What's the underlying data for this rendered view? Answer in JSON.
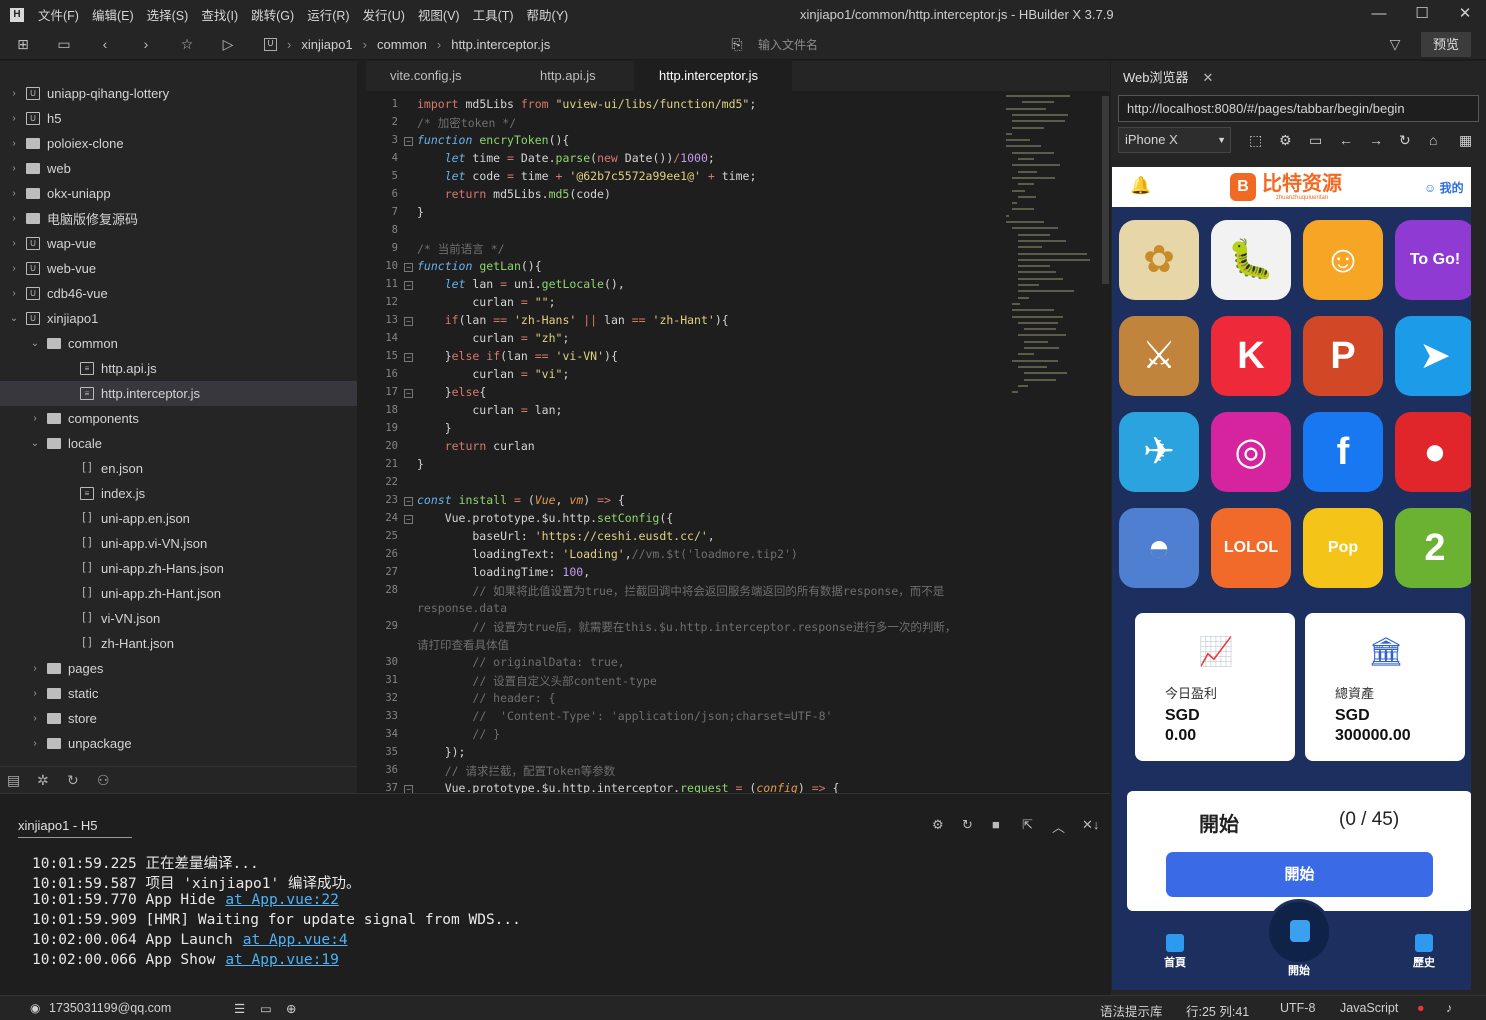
{
  "window": {
    "title": "xinjiapo1/common/http.interceptor.js - HBuilder X 3.7.9",
    "menu": [
      "文件(F)",
      "编辑(E)",
      "选择(S)",
      "查找(I)",
      "跳转(G)",
      "运行(R)",
      "发行(U)",
      "视图(V)",
      "工具(T)",
      "帮助(Y)"
    ]
  },
  "toolbar": {
    "breadcrumb": [
      "xinjiapo1",
      "common",
      "http.interceptor.js"
    ],
    "file_search_placeholder": "输入文件名",
    "preview_label": "预览"
  },
  "sidebar": {
    "items": [
      {
        "label": "uniapp-qihang-lottery",
        "type": "project",
        "depth": 0,
        "expanded": false
      },
      {
        "label": "h5",
        "type": "project",
        "depth": 0,
        "expanded": false
      },
      {
        "label": "poloiex-clone",
        "type": "folder",
        "depth": 0,
        "expanded": false
      },
      {
        "label": "web",
        "type": "folder",
        "depth": 0,
        "expanded": false
      },
      {
        "label": "okx-uniapp",
        "type": "folder",
        "depth": 0,
        "expanded": false
      },
      {
        "label": "电脑版修复源码",
        "type": "folder",
        "depth": 0,
        "expanded": false
      },
      {
        "label": "wap-vue",
        "type": "project",
        "depth": 0,
        "expanded": false
      },
      {
        "label": "web-vue",
        "type": "project",
        "depth": 0,
        "expanded": false
      },
      {
        "label": "cdb46-vue",
        "type": "project",
        "depth": 0,
        "expanded": false
      },
      {
        "label": "xinjiapo1",
        "type": "project",
        "depth": 0,
        "expanded": true
      },
      {
        "label": "common",
        "type": "folder",
        "depth": 1,
        "expanded": true
      },
      {
        "label": "http.api.js",
        "type": "file",
        "depth": 2
      },
      {
        "label": "http.interceptor.js",
        "type": "file",
        "depth": 2,
        "selected": true
      },
      {
        "label": "components",
        "type": "folder",
        "depth": 1,
        "expanded": false
      },
      {
        "label": "locale",
        "type": "folder",
        "depth": 1,
        "expanded": true
      },
      {
        "label": "en.json",
        "type": "json",
        "depth": 2
      },
      {
        "label": "index.js",
        "type": "file",
        "depth": 2
      },
      {
        "label": "uni-app.en.json",
        "type": "json",
        "depth": 2
      },
      {
        "label": "uni-app.vi-VN.json",
        "type": "json",
        "depth": 2
      },
      {
        "label": "uni-app.zh-Hans.json",
        "type": "json",
        "depth": 2
      },
      {
        "label": "uni-app.zh-Hant.json",
        "type": "json",
        "depth": 2
      },
      {
        "label": "vi-VN.json",
        "type": "json",
        "depth": 2
      },
      {
        "label": "zh-Hant.json",
        "type": "json",
        "depth": 2
      },
      {
        "label": "pages",
        "type": "folder",
        "depth": 1,
        "expanded": false
      },
      {
        "label": "static",
        "type": "folder",
        "depth": 1,
        "expanded": false
      },
      {
        "label": "store",
        "type": "folder",
        "depth": 1,
        "expanded": false
      },
      {
        "label": "unpackage",
        "type": "folder",
        "depth": 1,
        "expanded": false
      }
    ]
  },
  "editor": {
    "tabs": [
      "vite.config.js",
      "http.api.js",
      "http.interceptor.js"
    ],
    "active_tab": "http.interceptor.js",
    "lines": [
      {
        "n": "1",
        "html": "<span class='kw'>import</span> md5Libs <span class='kw'>from</span> <span class='st'>\"uview-ui/libs/function/md5\"</span>;"
      },
      {
        "n": "2",
        "html": "<span class='cm'>/* 加密token */</span>"
      },
      {
        "n": "3",
        "fold": true,
        "html": "<span class='kwi'>function</span> <span class='fn'>encryToken</span>(){"
      },
      {
        "n": "4",
        "html": "    <span class='kwi'>let</span> time <span class='kw'>=</span> Date.<span class='fn'>parse</span>(<span class='kw'>new</span> Date())<span class='kw'>/</span><span class='nm'>1000</span>;"
      },
      {
        "n": "5",
        "html": "    <span class='kwi'>let</span> code <span class='kw'>=</span> time <span class='kw'>+</span> <span class='st'>'@62b7c5572a99ee1@'</span> <span class='kw'>+</span> time;"
      },
      {
        "n": "6",
        "html": "    <span class='kw'>return</span> md5Libs.<span class='fn'>md5</span>(code)"
      },
      {
        "n": "7",
        "html": "}"
      },
      {
        "n": "8",
        "html": ""
      },
      {
        "n": "9",
        "html": "<span class='cm'>/* 当前语言 */</span>"
      },
      {
        "n": "10",
        "fold": true,
        "html": "<span class='kwi'>function</span> <span class='fn'>getLan</span>(){"
      },
      {
        "n": "11",
        "fold": true,
        "html": "    <span class='kwi'>let</span> lan <span class='kw'>=</span> uni.<span class='fn'>getLocale</span>(),"
      },
      {
        "n": "12",
        "html": "        curlan <span class='kw'>=</span> <span class='st'>\"\"</span>;"
      },
      {
        "n": "13",
        "fold": true,
        "html": "    <span class='kw'>if</span>(lan <span class='kw'>==</span> <span class='st'>'zh-Hans'</span> <span class='kw'>||</span> lan <span class='kw'>==</span> <span class='st'>'zh-Hant'</span>){"
      },
      {
        "n": "14",
        "html": "        curlan <span class='kw'>=</span> <span class='st'>\"zh\"</span>;"
      },
      {
        "n": "15",
        "fold": true,
        "html": "    }<span class='kw'>else</span> <span class='kw'>if</span>(lan <span class='kw'>==</span> <span class='st'>'vi-VN'</span>){"
      },
      {
        "n": "16",
        "html": "        curlan <span class='kw'>=</span> <span class='st'>\"vi\"</span>;"
      },
      {
        "n": "17",
        "fold": true,
        "html": "    }<span class='kw'>else</span>{"
      },
      {
        "n": "18",
        "html": "        curlan <span class='kw'>=</span> lan;"
      },
      {
        "n": "19",
        "html": "    }"
      },
      {
        "n": "20",
        "html": "    <span class='kw'>return</span> curlan"
      },
      {
        "n": "21",
        "html": "}"
      },
      {
        "n": "22",
        "html": ""
      },
      {
        "n": "23",
        "fold": true,
        "html": "<span class='kwi'>const</span> <span class='fn'>install</span> <span class='kw'>=</span> (<span class='ar'>Vue</span>, <span class='ar'>vm</span>) <span class='kw'>=&gt;</span> {"
      },
      {
        "n": "24",
        "fold": true,
        "html": "    Vue.prototype.$u.http.<span class='fn'>setConfig</span>({"
      },
      {
        "n": "25",
        "html": "        baseUrl: <span class='st'>'https://ceshi.eusdt.cc/'</span>,"
      },
      {
        "n": "26",
        "html": "        loadingText: <span class='st'>'Loading'</span>,<span class='cm'>//vm.$t('loadmore.tip2')</span>"
      },
      {
        "n": "27",
        "html": "        loadingTime: <span class='nm'>100</span>,"
      },
      {
        "n": "28",
        "html": "        <span class='cm'>// 如果将此值设置为true，拦截回调中将会返回服务端返回的所有数据response，而不是</span>"
      },
      {
        "n": "",
        "html": "<span class='cm'>response.data</span>"
      },
      {
        "n": "29",
        "html": "        <span class='cm'>// 设置为true后，就需要在this.$u.http.interceptor.response进行多一次的判断，</span>"
      },
      {
        "n": "",
        "html": "<span class='cm'>请打印查看具体值</span>"
      },
      {
        "n": "30",
        "html": "        <span class='cm'>// originalData: true,</span>"
      },
      {
        "n": "31",
        "html": "        <span class='cm'>// 设置自定义头部content-type</span>"
      },
      {
        "n": "32",
        "html": "        <span class='cm'>// header: {</span>"
      },
      {
        "n": "33",
        "html": "        <span class='cm'>//  'Content-Type': 'application/json;charset=UTF-8'</span>"
      },
      {
        "n": "34",
        "html": "        <span class='cm'>// }</span>"
      },
      {
        "n": "35",
        "html": "    });"
      },
      {
        "n": "36",
        "html": "    <span class='cm'>// 请求拦截，配置Token等参数</span>"
      },
      {
        "n": "37",
        "fold": true,
        "html": "    Vue.prototype.$u.http.interceptor.<span class='fn'>request</span> <span class='kw'>=</span> (<span class='ar'>config</span>) <span class='kw'>=&gt;</span> {"
      }
    ]
  },
  "console": {
    "tab_label": "xinjiapo1 - H5",
    "lines": [
      {
        "text": "10:01:59.225 正在差量编译...",
        "link": ""
      },
      {
        "text": "10:01:59.587 项目 'xinjiapo1' 编译成功。",
        "link": ""
      },
      {
        "text": "10:01:59.770 App Hide",
        "link": "at App.vue:22"
      },
      {
        "text": "10:01:59.909 [HMR] Waiting for update signal from WDS...",
        "link": ""
      },
      {
        "text": "10:02:00.064 App Launch",
        "link": "at App.vue:4"
      },
      {
        "text": "10:02:00.066 App Show",
        "link": "at App.vue:19"
      }
    ]
  },
  "statusbar": {
    "user": "1735031199@qq.com",
    "syntax_hint": "语法提示库",
    "position": "行:25  列:41",
    "encoding": "UTF-8",
    "language": "JavaScript"
  },
  "browser": {
    "tab_label": "Web浏览器",
    "url": "http://localhost:8080/#/pages/tabbar/begin/begin",
    "device": "iPhone X",
    "app": {
      "brand": "比特资源",
      "brand_sub": "zhuanzhuqulueritan",
      "me_label": "我的",
      "apps": [
        {
          "name": "anime-girl",
          "bg": "#e7d7a8",
          "glyph": "✿"
        },
        {
          "name": "worms",
          "bg": "#f2f2f2",
          "glyph": "🐛"
        },
        {
          "name": "subway-runner",
          "bg": "#f6a524",
          "glyph": "☺"
        },
        {
          "name": "togo",
          "bg": "#8e3ad3",
          "glyph": "To Go!"
        },
        {
          "name": "clash-of-clans",
          "bg": "#c1843c",
          "glyph": "⚔"
        },
        {
          "name": "kinemaster",
          "bg": "#ee2a3a",
          "glyph": "K"
        },
        {
          "name": "powerpoint",
          "bg": "#d24726",
          "glyph": "P"
        },
        {
          "name": "bird-app",
          "bg": "#1c9be8",
          "glyph": "➤"
        },
        {
          "name": "telegram",
          "bg": "#2aa3de",
          "glyph": "✈"
        },
        {
          "name": "instagram",
          "bg": "#d6249f",
          "glyph": "◎"
        },
        {
          "name": "facebook",
          "bg": "#1778f2",
          "glyph": "f"
        },
        {
          "name": "angry-birds",
          "bg": "#e0262b",
          "glyph": "●"
        },
        {
          "name": "pokemon-go",
          "bg": "#4f7fd0",
          "glyph": "◓"
        },
        {
          "name": "lolol",
          "bg": "#f26a2a",
          "glyph": "LOLOL"
        },
        {
          "name": "pop",
          "bg": "#f5c418",
          "glyph": "Pop"
        },
        {
          "name": "hill-climb-2",
          "bg": "#6bb233",
          "glyph": "2"
        }
      ],
      "cards": [
        {
          "label": "今日盈利",
          "currency": "SGD",
          "value": "0.00"
        },
        {
          "label": "總資產",
          "currency": "SGD",
          "value": "300000.00"
        }
      ],
      "start_title": "開始",
      "start_count": "(0 / 45)",
      "start_button": "開始",
      "tabs": [
        "首頁",
        "開始",
        "歷史"
      ]
    }
  }
}
